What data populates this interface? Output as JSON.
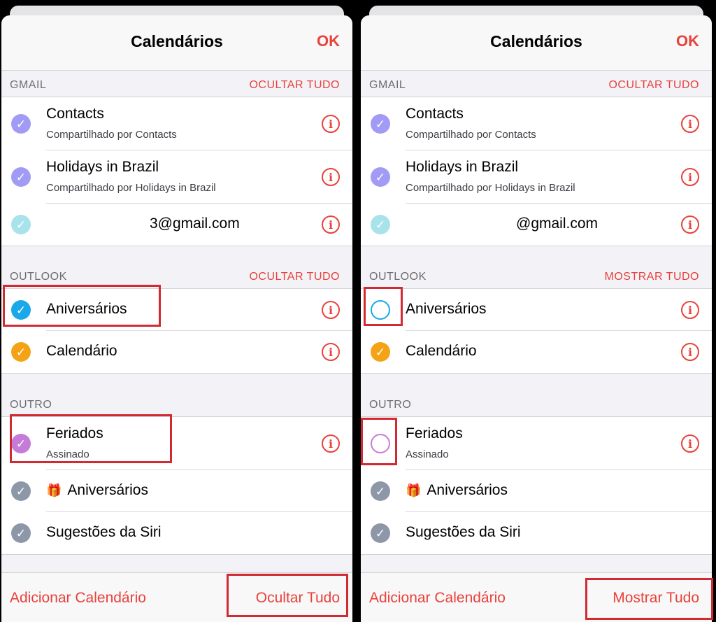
{
  "panels": [
    {
      "title": "Calendários",
      "ok_label": "OK",
      "gmail": {
        "header": "GMAIL",
        "action": "OCULTAR TUDO",
        "items": [
          {
            "title": "Contacts",
            "subtitle": "Compartilhado por Contacts",
            "color": "#a29bf5",
            "checked": true
          },
          {
            "title": "Holidays in Brazil",
            "subtitle": "Compartilhado por Holidays in Brazil",
            "color": "#a29bf5",
            "checked": true
          },
          {
            "title": "3@gmail.com",
            "color": "#a8e2ea",
            "checked": true
          }
        ]
      },
      "outlook": {
        "header": "OUTLOOK",
        "action": "OCULTAR TUDO",
        "items": [
          {
            "title": "Aniversários",
            "color": "#1aa8e8",
            "checked": true
          },
          {
            "title": "Calendário",
            "color": "#f5a316",
            "checked": true
          }
        ]
      },
      "outro": {
        "header": "OUTRO",
        "items": [
          {
            "title": "Feriados",
            "subtitle": "Assinado",
            "color": "#c77bd9",
            "checked": true
          },
          {
            "title": "Aniversários",
            "color": "#8e97a8",
            "checked": true
          },
          {
            "title": "Sugestões da Siri",
            "color": "#8e97a8",
            "checked": true
          }
        ]
      },
      "add_calendar": "Adicionar Calendário",
      "bottom_action": "Ocultar Tudo"
    },
    {
      "title": "Calendários",
      "ok_label": "OK",
      "gmail": {
        "header": "GMAIL",
        "action": "OCULTAR TUDO",
        "items": [
          {
            "title": "Contacts",
            "subtitle": "Compartilhado por Contacts",
            "color": "#a29bf5",
            "checked": true
          },
          {
            "title": "Holidays in Brazil",
            "subtitle": "Compartilhado por Holidays in Brazil",
            "color": "#a29bf5",
            "checked": true
          },
          {
            "title": "@gmail.com",
            "color": "#a8e2ea",
            "checked": true
          }
        ]
      },
      "outlook": {
        "header": "OUTLOOK",
        "action": "MOSTRAR TUDO",
        "items": [
          {
            "title": "Aniversários",
            "color": "#1aa8e8",
            "checked": false
          },
          {
            "title": "Calendário",
            "color": "#f5a316",
            "checked": true
          }
        ]
      },
      "outro": {
        "header": "OUTRO",
        "items": [
          {
            "title": "Feriados",
            "subtitle": "Assinado",
            "color": "#c77bd9",
            "checked": false
          },
          {
            "title": "Aniversários",
            "color": "#8e97a8",
            "checked": true
          },
          {
            "title": "Sugestões da Siri",
            "color": "#8e97a8",
            "checked": true
          }
        ]
      },
      "add_calendar": "Adicionar Calendário",
      "bottom_action": "Mostrar Tudo"
    }
  ],
  "highlight_color": "#d22a32",
  "icons": {
    "check": "checkmark-icon",
    "info": "info-icon",
    "gift": "gift-icon"
  }
}
